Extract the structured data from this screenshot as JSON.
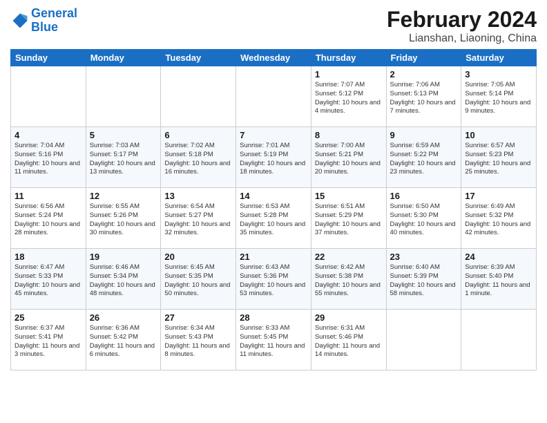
{
  "logo": {
    "line1": "General",
    "line2": "Blue"
  },
  "title": "February 2024",
  "subtitle": "Lianshan, Liaoning, China",
  "headers": [
    "Sunday",
    "Monday",
    "Tuesday",
    "Wednesday",
    "Thursday",
    "Friday",
    "Saturday"
  ],
  "weeks": [
    [
      {
        "day": "",
        "info": ""
      },
      {
        "day": "",
        "info": ""
      },
      {
        "day": "",
        "info": ""
      },
      {
        "day": "",
        "info": ""
      },
      {
        "day": "1",
        "info": "Sunrise: 7:07 AM\nSunset: 5:12 PM\nDaylight: 10 hours\nand 4 minutes."
      },
      {
        "day": "2",
        "info": "Sunrise: 7:06 AM\nSunset: 5:13 PM\nDaylight: 10 hours\nand 7 minutes."
      },
      {
        "day": "3",
        "info": "Sunrise: 7:05 AM\nSunset: 5:14 PM\nDaylight: 10 hours\nand 9 minutes."
      }
    ],
    [
      {
        "day": "4",
        "info": "Sunrise: 7:04 AM\nSunset: 5:16 PM\nDaylight: 10 hours\nand 11 minutes."
      },
      {
        "day": "5",
        "info": "Sunrise: 7:03 AM\nSunset: 5:17 PM\nDaylight: 10 hours\nand 13 minutes."
      },
      {
        "day": "6",
        "info": "Sunrise: 7:02 AM\nSunset: 5:18 PM\nDaylight: 10 hours\nand 16 minutes."
      },
      {
        "day": "7",
        "info": "Sunrise: 7:01 AM\nSunset: 5:19 PM\nDaylight: 10 hours\nand 18 minutes."
      },
      {
        "day": "8",
        "info": "Sunrise: 7:00 AM\nSunset: 5:21 PM\nDaylight: 10 hours\nand 20 minutes."
      },
      {
        "day": "9",
        "info": "Sunrise: 6:59 AM\nSunset: 5:22 PM\nDaylight: 10 hours\nand 23 minutes."
      },
      {
        "day": "10",
        "info": "Sunrise: 6:57 AM\nSunset: 5:23 PM\nDaylight: 10 hours\nand 25 minutes."
      }
    ],
    [
      {
        "day": "11",
        "info": "Sunrise: 6:56 AM\nSunset: 5:24 PM\nDaylight: 10 hours\nand 28 minutes."
      },
      {
        "day": "12",
        "info": "Sunrise: 6:55 AM\nSunset: 5:26 PM\nDaylight: 10 hours\nand 30 minutes."
      },
      {
        "day": "13",
        "info": "Sunrise: 6:54 AM\nSunset: 5:27 PM\nDaylight: 10 hours\nand 32 minutes."
      },
      {
        "day": "14",
        "info": "Sunrise: 6:53 AM\nSunset: 5:28 PM\nDaylight: 10 hours\nand 35 minutes."
      },
      {
        "day": "15",
        "info": "Sunrise: 6:51 AM\nSunset: 5:29 PM\nDaylight: 10 hours\nand 37 minutes."
      },
      {
        "day": "16",
        "info": "Sunrise: 6:50 AM\nSunset: 5:30 PM\nDaylight: 10 hours\nand 40 minutes."
      },
      {
        "day": "17",
        "info": "Sunrise: 6:49 AM\nSunset: 5:32 PM\nDaylight: 10 hours\nand 42 minutes."
      }
    ],
    [
      {
        "day": "18",
        "info": "Sunrise: 6:47 AM\nSunset: 5:33 PM\nDaylight: 10 hours\nand 45 minutes."
      },
      {
        "day": "19",
        "info": "Sunrise: 6:46 AM\nSunset: 5:34 PM\nDaylight: 10 hours\nand 48 minutes."
      },
      {
        "day": "20",
        "info": "Sunrise: 6:45 AM\nSunset: 5:35 PM\nDaylight: 10 hours\nand 50 minutes."
      },
      {
        "day": "21",
        "info": "Sunrise: 6:43 AM\nSunset: 5:36 PM\nDaylight: 10 hours\nand 53 minutes."
      },
      {
        "day": "22",
        "info": "Sunrise: 6:42 AM\nSunset: 5:38 PM\nDaylight: 10 hours\nand 55 minutes."
      },
      {
        "day": "23",
        "info": "Sunrise: 6:40 AM\nSunset: 5:39 PM\nDaylight: 10 hours\nand 58 minutes."
      },
      {
        "day": "24",
        "info": "Sunrise: 6:39 AM\nSunset: 5:40 PM\nDaylight: 11 hours\nand 1 minute."
      }
    ],
    [
      {
        "day": "25",
        "info": "Sunrise: 6:37 AM\nSunset: 5:41 PM\nDaylight: 11 hours\nand 3 minutes."
      },
      {
        "day": "26",
        "info": "Sunrise: 6:36 AM\nSunset: 5:42 PM\nDaylight: 11 hours\nand 6 minutes."
      },
      {
        "day": "27",
        "info": "Sunrise: 6:34 AM\nSunset: 5:43 PM\nDaylight: 11 hours\nand 8 minutes."
      },
      {
        "day": "28",
        "info": "Sunrise: 6:33 AM\nSunset: 5:45 PM\nDaylight: 11 hours\nand 11 minutes."
      },
      {
        "day": "29",
        "info": "Sunrise: 6:31 AM\nSunset: 5:46 PM\nDaylight: 11 hours\nand 14 minutes."
      },
      {
        "day": "",
        "info": ""
      },
      {
        "day": "",
        "info": ""
      }
    ]
  ]
}
